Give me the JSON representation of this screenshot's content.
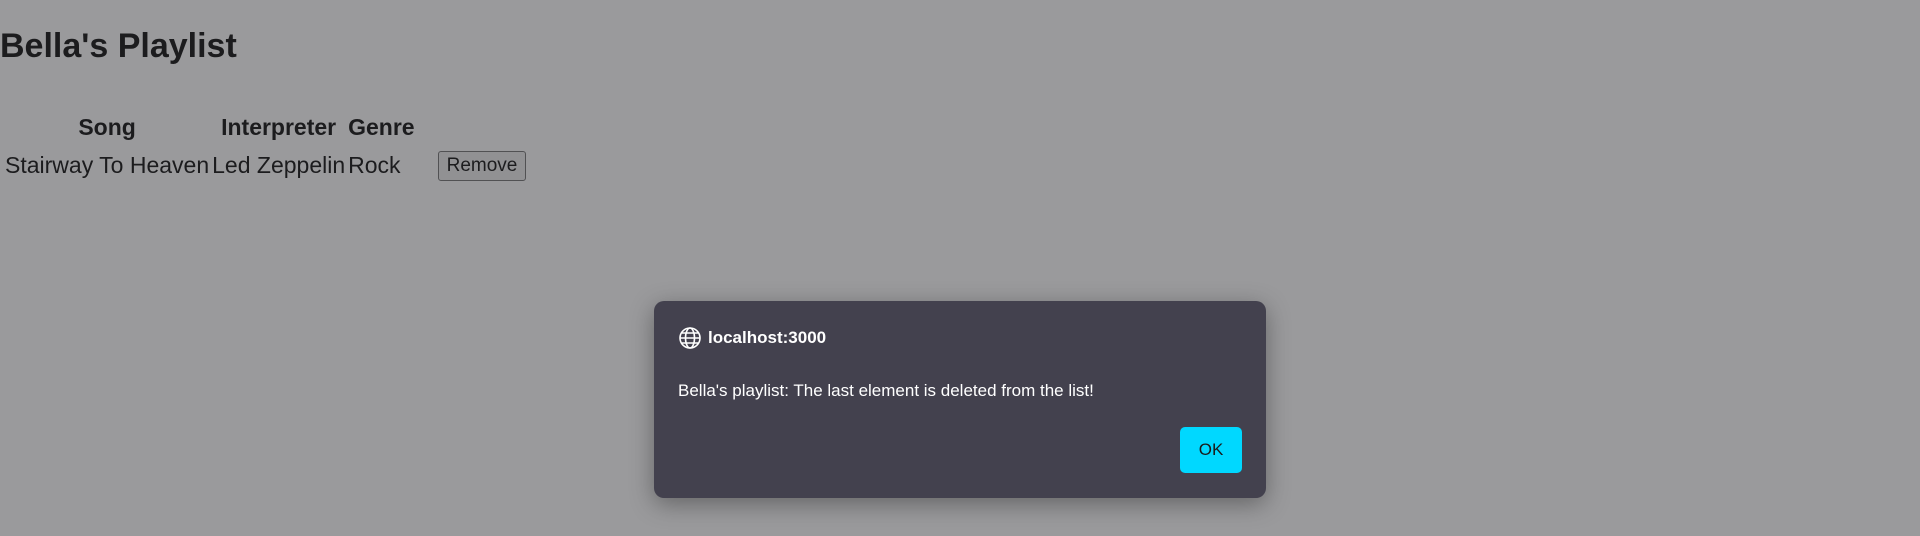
{
  "page": {
    "title": "Bella's Playlist"
  },
  "table": {
    "headers": [
      "Song",
      "Interpreter",
      "Genre"
    ],
    "rows": [
      {
        "song": "Stairway To Heaven",
        "interpreter": "Led Zeppelin",
        "genre": "Rock",
        "action_label": "Remove"
      }
    ]
  },
  "dialog": {
    "origin": "localhost:3000",
    "message": "Bella's playlist: The last element is deleted from the list!",
    "ok_label": "OK",
    "icon": "globe-icon",
    "accent_color": "#00d8ff",
    "background_color": "#43414e"
  }
}
